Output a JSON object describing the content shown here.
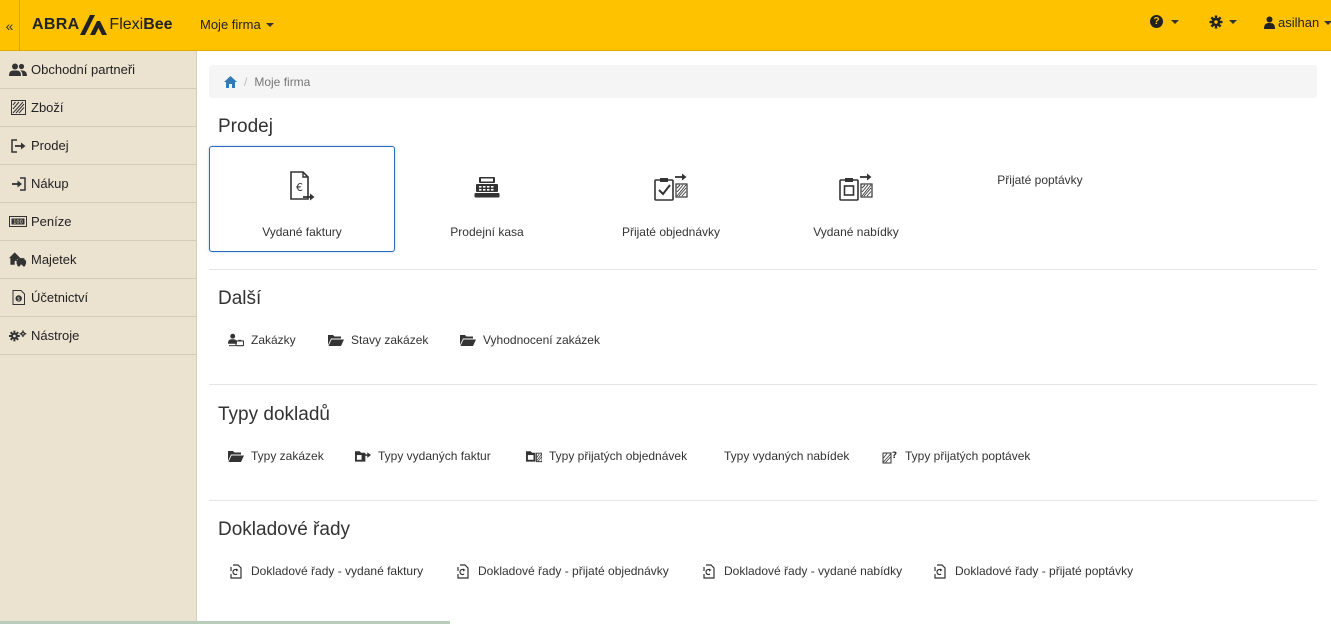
{
  "header": {
    "logo_abra": "ABRA",
    "logo_flexi": "Flexi",
    "logo_bee": "Bee",
    "company_menu": "Moje firma",
    "user_name": "asilhan",
    "brand_color": "#fec200"
  },
  "sidebar": {
    "items": [
      {
        "label": "Obchodní partneři",
        "icon": "partners-icon"
      },
      {
        "label": "Zboží",
        "icon": "goods-icon"
      },
      {
        "label": "Prodej",
        "icon": "sale-icon"
      },
      {
        "label": "Nákup",
        "icon": "purchase-icon"
      },
      {
        "label": "Peníze",
        "icon": "money-icon"
      },
      {
        "label": "Majetek",
        "icon": "property-icon"
      },
      {
        "label": "Účetnictví",
        "icon": "accounting-icon"
      },
      {
        "label": "Nástroje",
        "icon": "tools-icon"
      }
    ]
  },
  "breadcrumb": {
    "current": "Moje firma"
  },
  "sections": {
    "prodej": {
      "title": "Prodej",
      "tiles": [
        {
          "label": "Vydané faktury",
          "icon": "invoice-euro-icon"
        },
        {
          "label": "Prodejní kasa",
          "icon": "cash-register-icon"
        },
        {
          "label": "Přijaté objednávky",
          "icon": "received-orders-icon"
        },
        {
          "label": "Vydané nabídky",
          "icon": "issued-offers-icon"
        },
        {
          "label": "Přijaté poptávky",
          "icon": ""
        }
      ]
    },
    "dalsi": {
      "title": "Další",
      "links": [
        {
          "label": "Zakázky",
          "icon": "orders-user-icon"
        },
        {
          "label": "Stavy zakázek",
          "icon": "folder-open-icon"
        },
        {
          "label": "Vyhodnocení zakázek",
          "icon": "folder-open-icon"
        }
      ]
    },
    "typy": {
      "title": "Typy dokladů",
      "links": [
        {
          "label": "Typy zakázek",
          "icon": "folder-open-icon"
        },
        {
          "label": "Typy vydaných faktur",
          "icon": "folder-export-icon"
        },
        {
          "label": "Typy přijatých objednávek",
          "icon": "folder-doc-icon"
        },
        {
          "label": "Typy vydaných nabídek",
          "icon": ""
        },
        {
          "label": "Typy přijatých poptávek",
          "icon": "inquiry-icon"
        }
      ]
    },
    "rady": {
      "title": "Dokladové řady",
      "links": [
        {
          "label": "Dokladové řady - vydané faktury",
          "icon": "doc-series-icon"
        },
        {
          "label": "Dokladové řady - přijaté objednávky",
          "icon": "doc-series-icon"
        },
        {
          "label": "Dokladové řady - vydané nabídky",
          "icon": "doc-series-icon"
        },
        {
          "label": "Dokladové řady - přijaté poptávky",
          "icon": "doc-series-icon"
        }
      ]
    }
  }
}
